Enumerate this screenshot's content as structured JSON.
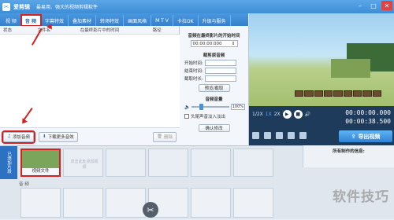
{
  "window": {
    "app_name": "爱剪辑",
    "slogan": "最易用、强大的视频剪辑软件"
  },
  "tabs": [
    "视 频",
    "音 频",
    "字幕特效",
    "叠加素材",
    "转场特效",
    "画面风格",
    "M T V",
    "卡拉OK",
    "升级与服务"
  ],
  "active_tab": "音 频",
  "list_columns": [
    "状态",
    "文件名",
    "在最终影片中的时间",
    "路径"
  ],
  "buttons": {
    "add_audio": "添加音频",
    "download_more": "下载更多音效",
    "delete": "删除"
  },
  "mid_panel": {
    "start_title": "音频在最终影片的开始时间",
    "start_time": "00:00:00.000",
    "clip_title": "裁剪原音频",
    "start_label": "开始时间:",
    "end_label": "结束时间:",
    "duration_label": "截取时长:",
    "pick_button": "预览/截取",
    "volume_title": "音频音量",
    "volume_value": "100%",
    "fade_label": "头尾声音淡入淡出",
    "confirm_button": "确认修改"
  },
  "player": {
    "speeds": [
      "1/2X",
      "1X",
      "2X"
    ],
    "active_speed": "1X",
    "current_time": "00:00:00.000",
    "total_time": "00:00:38.500",
    "export_label": "导出视频"
  },
  "timeline": {
    "side_label": "已添加片段",
    "video_clip_label": "视频文件",
    "hint": "双击此处添加视频",
    "audio_label": "音 频",
    "info_title": "所有制作的信息:"
  },
  "watermark": "软件技巧"
}
